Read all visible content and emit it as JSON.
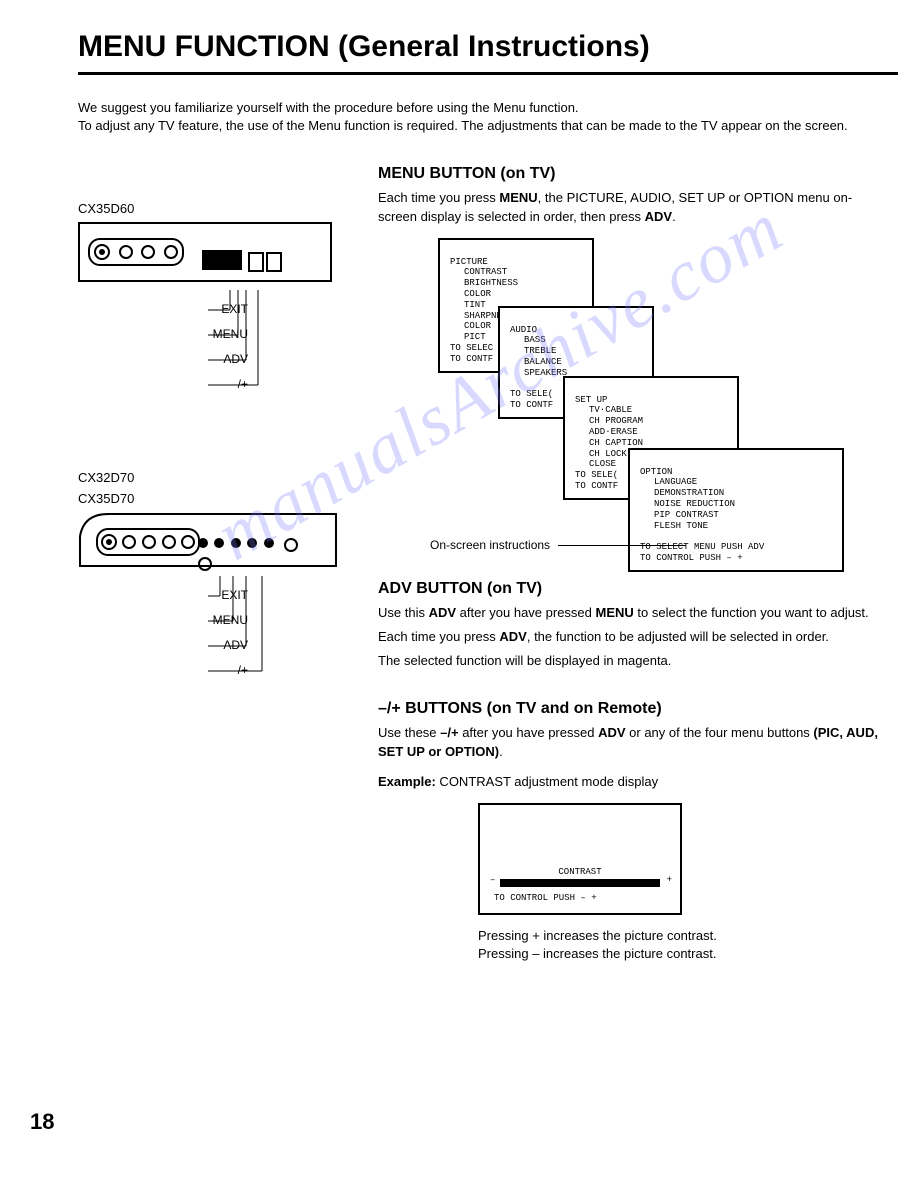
{
  "title": "MENU FUNCTION (General Instructions)",
  "intro": {
    "line1": "We suggest you familiarize yourself with the procedure before using the Menu function.",
    "line2": "To adjust any TV feature, the use of the Menu function is required.  The adjustments that can be made to the TV appear on the screen."
  },
  "models": {
    "a": "CX35D60",
    "b1": "CX32D70",
    "b2": "CX35D70"
  },
  "panel_labels": {
    "exit": "EXIT",
    "menu": "MENU",
    "adv": "ADV",
    "pm": "– /+"
  },
  "sections": {
    "menu_button": {
      "heading": "MENU BUTTON (on TV)",
      "body": "Each time you press MENU, the PICTURE, AUDIO, SET UP or OPTION menu on-screen display is selected in order, then press ADV."
    },
    "adv_button": {
      "heading": "ADV BUTTON (on TV)",
      "body1": "Use this ADV after you have pressed MENU to select the function you want to adjust.",
      "body2": "Each time you press ADV, the function to be adjusted will be selected in order.",
      "body3": "The selected function will be displayed in magenta."
    },
    "pm_buttons": {
      "heading": "–/+ BUTTONS (on TV and on Remote)",
      "body1": "Use these –/+ after you have pressed ADV or any of the four menu buttons (PIC, AUD, SET UP or OPTION).",
      "example_prefix": "Example:",
      "example": " CONTRAST adjustment mode display"
    }
  },
  "menus": {
    "picture": {
      "head": "PICTURE",
      "items": [
        "CONTRAST",
        "BRIGHTNESS",
        "COLOR",
        "TINT",
        "SHARPNESS",
        "COLOR",
        "PICT"
      ],
      "foot": "TO SELEC\nTO CONTF"
    },
    "audio": {
      "head": "AUDIO",
      "items": [
        "BASS",
        "TREBLE",
        "BALANCE",
        "SPEAKERS"
      ],
      "foot": "TO SELE(\nTO CONTF"
    },
    "setup": {
      "head": "SET UP",
      "items": [
        "TV·CABLE",
        "CH PROGRAM",
        "ADD·ERASE",
        "CH CAPTION",
        "CH LOCK",
        "CLOSE"
      ],
      "foot": "TO SELE(\nTO CONTF"
    },
    "option": {
      "head": "OPTION",
      "items": [
        "LANGUAGE",
        "DEMONSTRATION",
        "NOISE REDUCTION",
        "PIP CONTRAST",
        "FLESH TONE"
      ],
      "foot": "TO SELECT MENU PUSH ADV\nTO CONTROL PUSH – +"
    },
    "onscreen_label": "On-screen instructions"
  },
  "contrast": {
    "label": "CONTRAST",
    "minus": "–",
    "plus": "+",
    "foot": "TO CONTROL PUSH – +",
    "after1": "Pressing + increases the picture contrast.",
    "after2": "Pressing – increases the picture contrast."
  },
  "watermark": "manualsArchive.com",
  "page_number": "18"
}
